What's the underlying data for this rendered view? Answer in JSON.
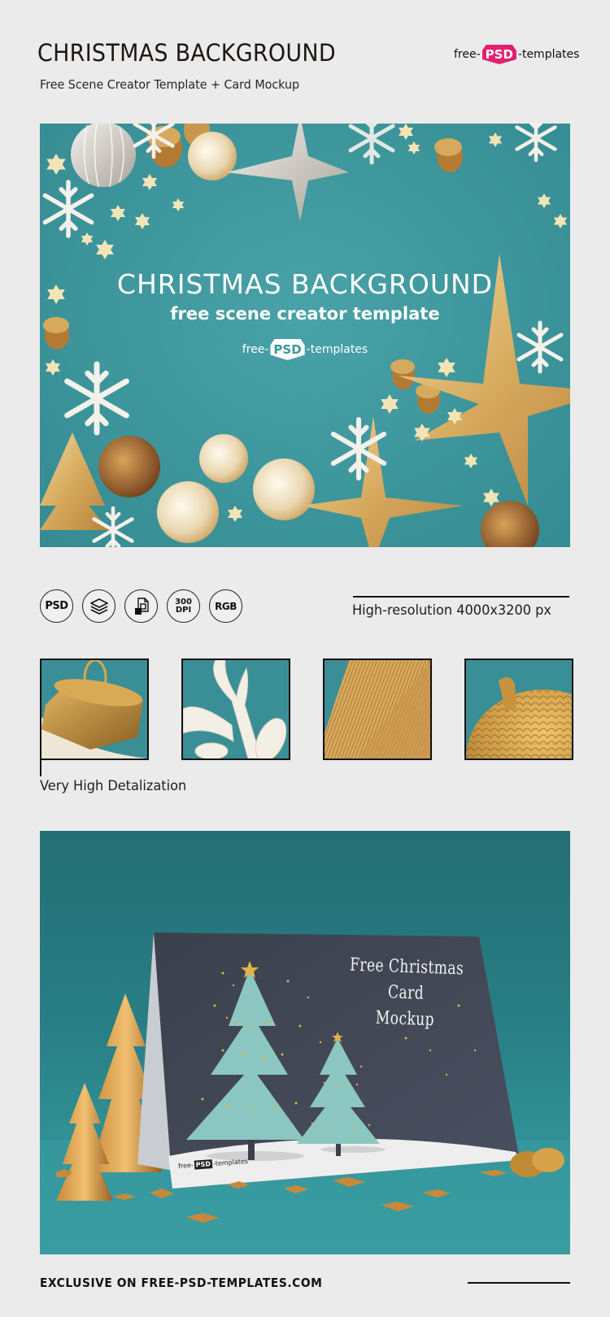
{
  "header": {
    "title": "CHRISTMAS BACKGROUND",
    "subtitle": "Free Scene Creator Template + Card Mockup",
    "brand": {
      "left": "free-",
      "mid": "PSD",
      "right": "-templates"
    }
  },
  "hero": {
    "title": "CHRISTMAS BACKGROUND",
    "subtitle": "free scene creator template",
    "brand": {
      "left": "free-",
      "mid": "PSD",
      "right": "-templates"
    },
    "colors": {
      "background": "#3e979d",
      "gold": "#d9b46a",
      "white": "#f4f1ea"
    }
  },
  "features": {
    "badges": [
      {
        "icon": "psd-icon",
        "label": "PSD"
      },
      {
        "icon": "layers-icon",
        "label": ""
      },
      {
        "icon": "smart-object-icon",
        "label": ""
      },
      {
        "icon": "dpi-icon",
        "label_top": "300",
        "label_bottom": "DPI"
      },
      {
        "icon": "rgb-icon",
        "label": "RGB"
      }
    ],
    "resolution": "High-resolution 4000x3200 px"
  },
  "details": {
    "caption": "Very High Detalization",
    "thumbnails": [
      {
        "name": "ornament-cap"
      },
      {
        "name": "snowflake-detail"
      },
      {
        "name": "gold-star-texture"
      },
      {
        "name": "gold-acorn"
      }
    ]
  },
  "mockup": {
    "card_title_line1": "Free Christmas Card",
    "card_title_line2": "Mockup",
    "card_brand": {
      "left": "free-",
      "mid": "PSD",
      "right": "-templates"
    },
    "colors": {
      "background": "#287e84",
      "card": "#3d4350",
      "tree": "#8cc6c0",
      "gold": "#e0b24a"
    }
  },
  "footer": {
    "text": "EXCLUSIVE ON FREE-PSD-TEMPLATES.COM"
  }
}
